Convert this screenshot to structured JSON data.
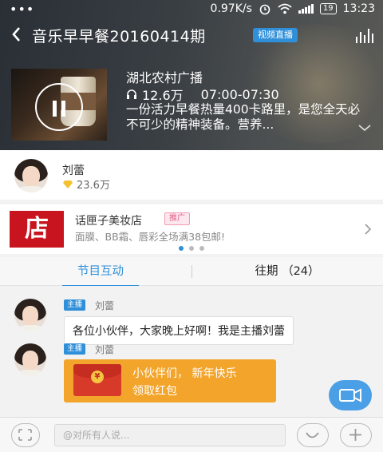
{
  "status_bar": {
    "network_speed": "0.97K/s",
    "battery": "19",
    "time": "13:23"
  },
  "header": {
    "title": "音乐早早餐20160414期",
    "badge": "视频直播"
  },
  "program": {
    "station": "湖北农村广播",
    "listeners": "12.6万",
    "time_slot": "07:00-07:30",
    "description": "一份活力早餐热量400卡路里，是您全天必不可少的精神装备。营养..."
  },
  "anchor": {
    "name": "刘蕾",
    "fans": "23.6万"
  },
  "ad": {
    "logo_text": "店",
    "title": "话匣子美妆店",
    "tag": "推广",
    "subtitle": "面膜、BB霜、唇彩全场满38包邮!"
  },
  "tabs": [
    {
      "label": "节目互动",
      "active": true
    },
    {
      "label": "往期 （24）",
      "active": false
    }
  ],
  "messages": [
    {
      "role": "主播",
      "sender": "刘蕾",
      "text": "各位小伙伴，大家晚上好啊！我是主播刘蕾"
    },
    {
      "role": "主播",
      "sender": "刘蕾",
      "red_packet_line1": "小伙伴们，  新年快乐",
      "red_packet_line2": "领取红包"
    }
  ],
  "input": {
    "placeholder": "@对所有人说..."
  },
  "colors": {
    "accent": "#2f8fd8",
    "red_packet": "#f3a42a",
    "ad_logo": "#c8141e"
  }
}
